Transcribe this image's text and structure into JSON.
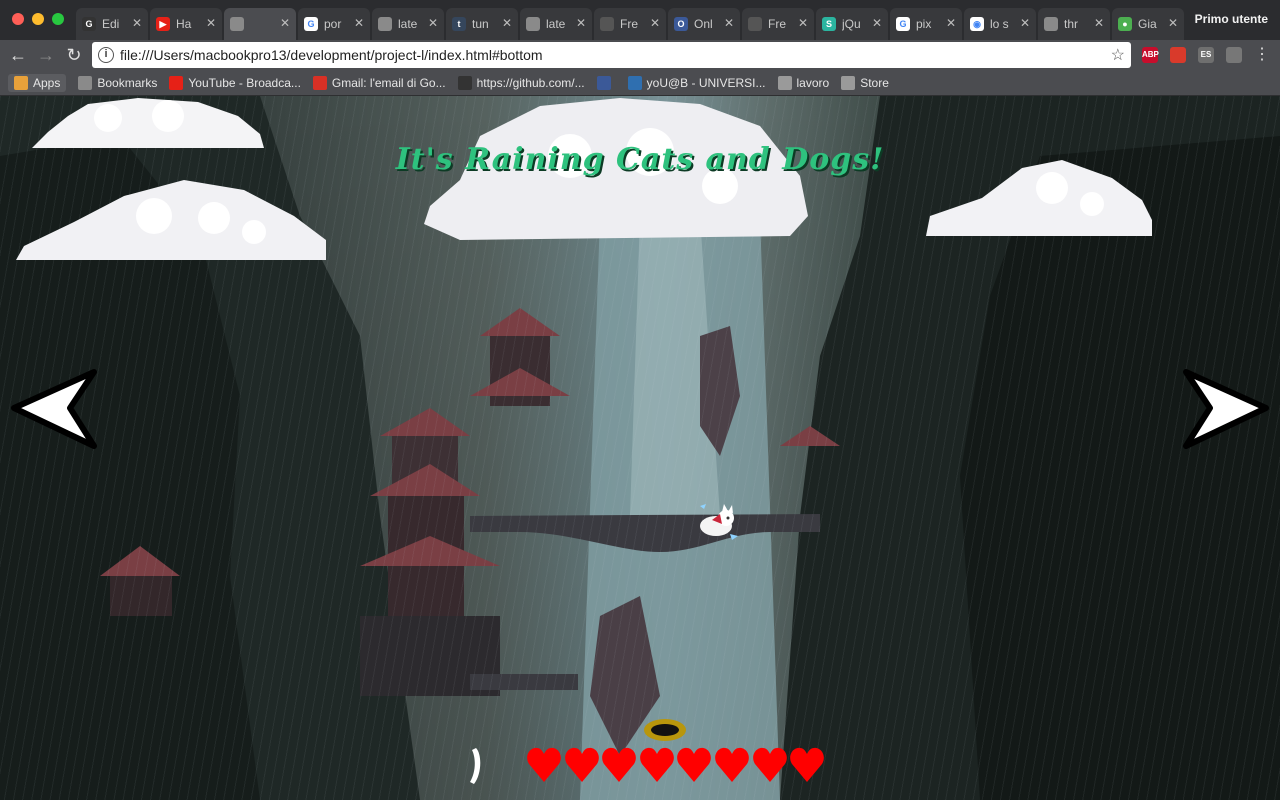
{
  "browser": {
    "profile_label": "Primo utente",
    "tabs": [
      {
        "label": "Edi",
        "icon": "github-icon",
        "color": "#333333",
        "glyph": "G"
      },
      {
        "label": "Ha",
        "icon": "youtube-icon",
        "color": "#e62117",
        "glyph": "▶"
      },
      {
        "label": "",
        "icon": "document-icon",
        "color": "#8a8a8a",
        "glyph": "",
        "active": true
      },
      {
        "label": "por",
        "icon": "google-icon",
        "color": "#ffffff",
        "glyph": "G"
      },
      {
        "label": "late",
        "icon": "document-icon",
        "color": "#8a8a8a",
        "glyph": ""
      },
      {
        "label": "tun",
        "icon": "tumblr-icon",
        "color": "#35465c",
        "glyph": "t"
      },
      {
        "label": "late",
        "icon": "document-icon",
        "color": "#8a8a8a",
        "glyph": ""
      },
      {
        "label": "Fre",
        "icon": "document-icon",
        "color": "#555555",
        "glyph": ""
      },
      {
        "label": "Onl",
        "icon": "site-icon",
        "color": "#3b5998",
        "glyph": "O"
      },
      {
        "label": "Fre",
        "icon": "document-icon",
        "color": "#555555",
        "glyph": ""
      },
      {
        "label": "jQu",
        "icon": "site-icon",
        "color": "#2bb5a0",
        "glyph": "S"
      },
      {
        "label": "pix",
        "icon": "google-icon",
        "color": "#ffffff",
        "glyph": "G"
      },
      {
        "label": "lo s",
        "icon": "site-icon",
        "color": "#ffffff",
        "glyph": "◉"
      },
      {
        "label": "thr",
        "icon": "document-icon",
        "color": "#8a8a8a",
        "glyph": ""
      },
      {
        "label": "Gia",
        "icon": "site-icon",
        "color": "#4caf50",
        "glyph": "●"
      }
    ],
    "url": "file:///Users/macbookpro13/development/project-l/index.html#bottom",
    "extensions": [
      {
        "name": "adblock-icon",
        "label": "ABP",
        "color": "#c70d2c"
      },
      {
        "name": "extension-red-icon",
        "label": "",
        "color": "#d93a2b"
      },
      {
        "name": "extension-es-icon",
        "label": "ES",
        "color": "#6f6f6f"
      },
      {
        "name": "extension-sync-icon",
        "label": "",
        "color": "#777777"
      }
    ],
    "bookmarks": [
      {
        "label": "Apps",
        "icon": "apps-icon",
        "color": "#e8a13a"
      },
      {
        "label": "Bookmarks",
        "icon": "star-icon",
        "color": "#8a8a8a"
      },
      {
        "label": "YouTube - Broadca...",
        "icon": "youtube-icon",
        "color": "#e62117"
      },
      {
        "label": "Gmail: l'email di Go...",
        "icon": "gmail-icon",
        "color": "#d93025"
      },
      {
        "label": "https://github.com/...",
        "icon": "github-icon",
        "color": "#333333"
      },
      {
        "label": "",
        "icon": "facebook-icon",
        "color": "#3b5998"
      },
      {
        "label": "yoU@B - UNIVERSI...",
        "icon": "site-icon",
        "color": "#2f6fb0"
      },
      {
        "label": "lavoro",
        "icon": "folder-icon",
        "color": "#9a9a9a"
      },
      {
        "label": "Store",
        "icon": "page-icon",
        "color": "#9a9a9a"
      }
    ]
  },
  "game": {
    "title": "It's Raining Cats and Dogs!",
    "lives": 8,
    "colors": {
      "title": "#2ec27e",
      "heart": "#ff0000",
      "arrow_fill": "#ffffff",
      "arrow_stroke": "#000000"
    }
  }
}
